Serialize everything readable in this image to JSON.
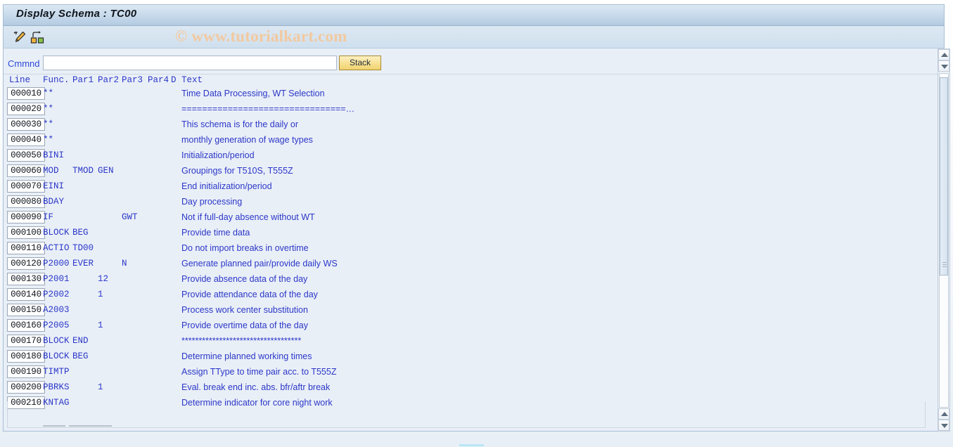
{
  "window": {
    "title": "Display Schema : TC00"
  },
  "toolbar": {
    "icons": [
      {
        "name": "edit-pencil-icon",
        "label": "Change"
      },
      {
        "name": "hierarchy-structure-icon",
        "label": "Structure"
      }
    ],
    "watermark": "© www.tutorialkart.com"
  },
  "command": {
    "label": "Cmmnd",
    "value": "",
    "placeholder": "",
    "stack_label": "Stack"
  },
  "table": {
    "columns": [
      "Line",
      "Func.",
      "Par1",
      "Par2",
      "Par3",
      "Par4",
      "D",
      "Text"
    ],
    "rows": [
      {
        "line": "000010",
        "func": "**",
        "par1": "",
        "par2": "",
        "par3": "",
        "par4": "",
        "d": "",
        "text": "Time Data Processing, WT Selection"
      },
      {
        "line": "000020",
        "func": "**",
        "par1": "",
        "par2": "",
        "par3": "",
        "par4": "",
        "d": "",
        "text": "================================…"
      },
      {
        "line": "000030",
        "func": "**",
        "par1": "",
        "par2": "",
        "par3": "",
        "par4": "",
        "d": "",
        "text": "This schema is for the daily or"
      },
      {
        "line": "000040",
        "func": "**",
        "par1": "",
        "par2": "",
        "par3": "",
        "par4": "",
        "d": "",
        "text": "monthly generation of wage types"
      },
      {
        "line": "000050",
        "func": "BINI",
        "par1": "",
        "par2": "",
        "par3": "",
        "par4": "",
        "d": "",
        "text": "Initialization/period"
      },
      {
        "line": "000060",
        "func": "MOD",
        "par1": "TMOD",
        "par2": "GEN",
        "par3": "",
        "par4": "",
        "d": "",
        "text": "Groupings for T510S, T555Z"
      },
      {
        "line": "000070",
        "func": "EINI",
        "par1": "",
        "par2": "",
        "par3": "",
        "par4": "",
        "d": "",
        "text": "End initialization/period"
      },
      {
        "line": "000080",
        "func": "BDAY",
        "par1": "",
        "par2": "",
        "par3": "",
        "par4": "",
        "d": "",
        "text": "Day processing"
      },
      {
        "line": "000090",
        "func": "IF",
        "par1": "",
        "par2": "",
        "par3": "GWT",
        "par4": "",
        "d": "",
        "text": "Not if full-day absence without WT"
      },
      {
        "line": "000100",
        "func": "BLOCK",
        "par1": "BEG",
        "par2": "",
        "par3": "",
        "par4": "",
        "d": "",
        "text": "Provide time data"
      },
      {
        "line": "000110",
        "func": "ACTIO",
        "par1": "TD00",
        "par2": "",
        "par3": "",
        "par4": "",
        "d": "",
        "text": "Do not import breaks in overtime"
      },
      {
        "line": "000120",
        "func": "P2000",
        "par1": "EVER",
        "par2": "",
        "par3": "N",
        "par4": "",
        "d": "",
        "text": "Generate planned pair/provide daily WS"
      },
      {
        "line": "000130",
        "func": "P2001",
        "par1": "",
        "par2": "12",
        "par3": "",
        "par4": "",
        "d": "",
        "text": "Provide absence data of the day"
      },
      {
        "line": "000140",
        "func": "P2002",
        "par1": "",
        "par2": "1",
        "par3": "",
        "par4": "",
        "d": "",
        "text": "Provide attendance data of the day"
      },
      {
        "line": "000150",
        "func": "A2003",
        "par1": "",
        "par2": "",
        "par3": "",
        "par4": "",
        "d": "",
        "text": "Process work center substitution"
      },
      {
        "line": "000160",
        "func": "P2005",
        "par1": "",
        "par2": "1",
        "par3": "",
        "par4": "",
        "d": "",
        "text": "Provide overtime data of the day"
      },
      {
        "line": "000170",
        "func": "BLOCK",
        "par1": "END",
        "par2": "",
        "par3": "",
        "par4": "",
        "d": "",
        "text": "***********************************"
      },
      {
        "line": "000180",
        "func": "BLOCK",
        "par1": "BEG",
        "par2": "",
        "par3": "",
        "par4": "",
        "d": "",
        "text": "Determine planned working times"
      },
      {
        "line": "000190",
        "func": "TIMTP",
        "par1": "",
        "par2": "",
        "par3": "",
        "par4": "",
        "d": "",
        "text": "Assign TType to time pair acc. to T555Z"
      },
      {
        "line": "000200",
        "func": "PBRKS",
        "par1": "",
        "par2": "1",
        "par3": "",
        "par4": "",
        "d": "",
        "text": "Eval. break end inc. abs. bfr/aftr break"
      },
      {
        "line": "000210",
        "func": "KNTAG",
        "par1": "",
        "par2": "",
        "par3": "",
        "par4": "",
        "d": "",
        "text": "Determine indicator for core night work"
      }
    ]
  },
  "scrollbars": {
    "vertical": {
      "up": "scroll-up",
      "down": "scroll-down"
    },
    "horizontal": {
      "up": "scroll-up",
      "down": "scroll-down"
    }
  },
  "colors": {
    "accent_blue": "#2b37c8",
    "title_bar": "#b6cde2",
    "panel": "#e9eff7",
    "button_yellow": "#f7e08f",
    "watermark": "#f2c9a0"
  }
}
